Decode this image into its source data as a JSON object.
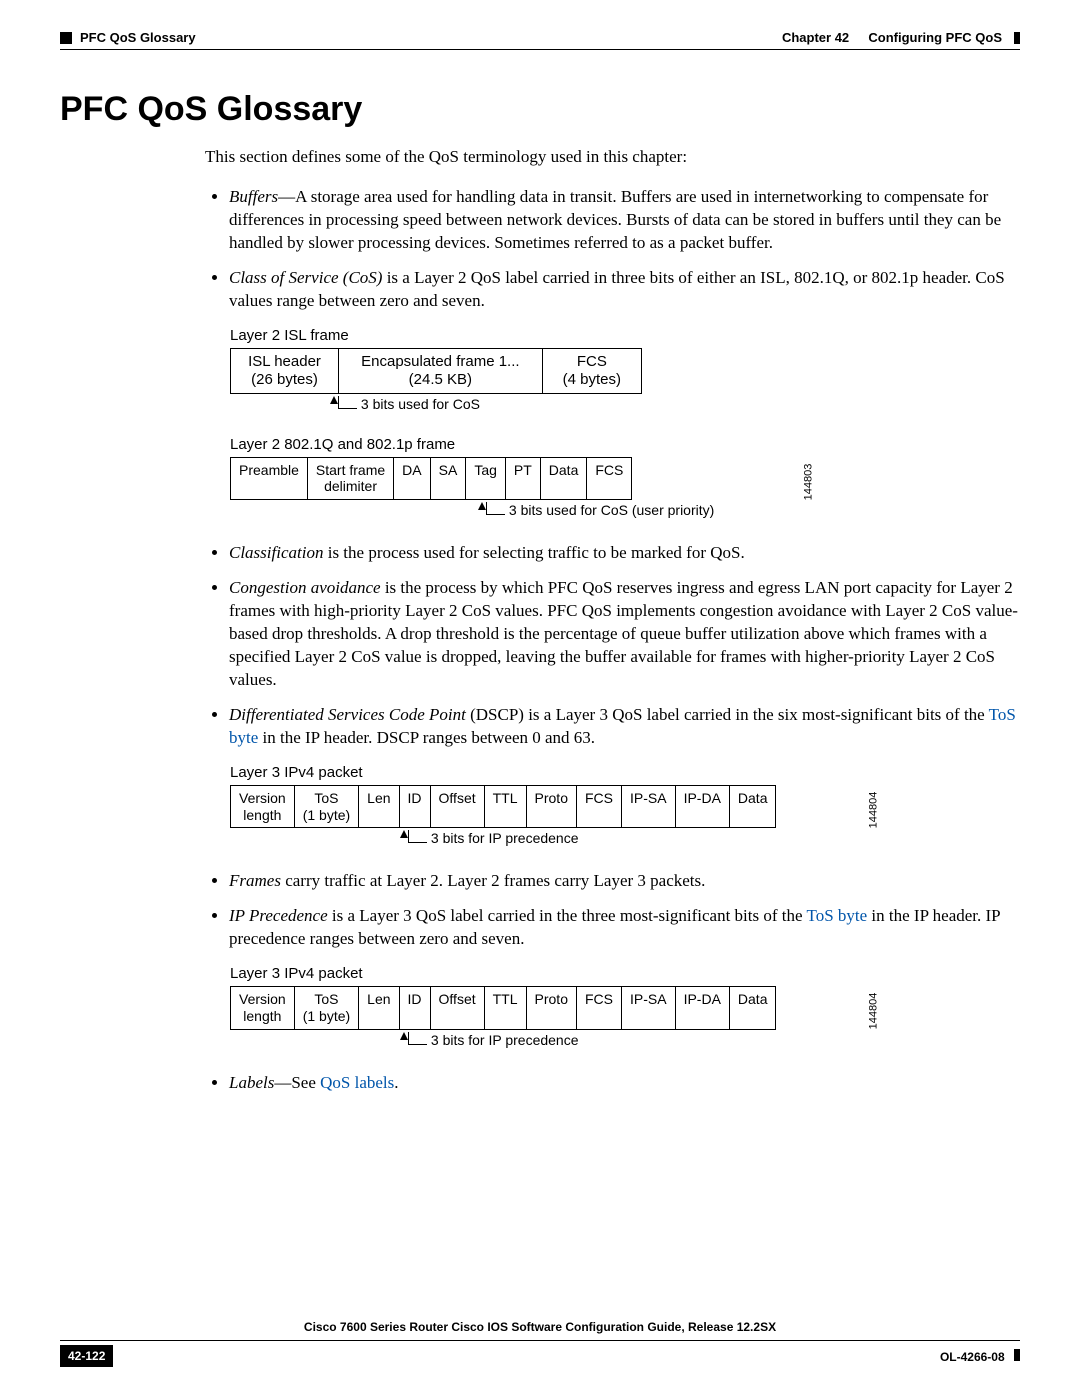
{
  "header": {
    "left_section": "PFC QoS Glossary",
    "right_chapter": "Chapter 42",
    "right_title": "Configuring PFC QoS"
  },
  "title": "PFC QoS Glossary",
  "intro": "This section defines some of the QoS terminology used in this chapter:",
  "items": {
    "buffers_term": "Buffers",
    "buffers_text": "—A storage area used for handling data in transit. Buffers are used in internetworking to compensate for differences in processing speed between network devices. Bursts of data can be stored in buffers until they can be handled by slower processing devices. Sometimes referred to as a packet buffer.",
    "cos_term": "Class of Service (CoS)",
    "cos_text": " is a Layer 2 QoS label carried in three bits of either an ISL, 802.1Q, or 802.1p header. CoS values range between zero and seven.",
    "classification_term": "Classification",
    "classification_text": " is the process used for selecting traffic to be marked for QoS.",
    "congestion_term": "Congestion avoidance",
    "congestion_text": " is the process by which PFC QoS reserves ingress and egress LAN port capacity for Layer 2 frames with high-priority Layer 2 CoS values. PFC QoS implements congestion avoidance with Layer 2 CoS value-based drop thresholds. A drop threshold is the percentage of queue buffer utilization above which frames with a specified Layer 2 CoS value is dropped, leaving the buffer available for frames with higher-priority Layer 2 CoS values.",
    "dscp_term": "Differentiated Services Code Point",
    "dscp_text_a": " (DSCP) is a Layer 3 QoS label carried in the six most-significant bits of the ",
    "dscp_link": "ToS byte",
    "dscp_text_b": " in the IP header. DSCP ranges between 0 and 63.",
    "frames_term": "Frames",
    "frames_text": " carry traffic at Layer 2. Layer 2 frames carry Layer 3 packets.",
    "ipprec_term": "IP Precedence",
    "ipprec_text_a": " is a Layer 3 QoS label carried in the three most-significant bits of the ",
    "ipprec_link": "ToS byte",
    "ipprec_text_b": " in the IP header. IP precedence ranges between zero and seven.",
    "labels_term": "Labels",
    "labels_sep": "—See ",
    "labels_link": "QoS labels",
    "labels_end": "."
  },
  "diagrams": {
    "isl": {
      "caption": "Layer 2 ISL frame",
      "cells": {
        "c0a": "ISL header",
        "c0b": "(26 bytes)",
        "c1a": "Encapsulated frame 1...",
        "c1b": "(24.5 KB)",
        "c2a": "FCS",
        "c2b": "(4 bytes)"
      },
      "annot": "3 bits used for CoS"
    },
    "dot1q": {
      "caption": "Layer 2 802.1Q and 802.1p frame",
      "cells": {
        "c0": "Preamble",
        "c1a": "Start frame",
        "c1b": "delimiter",
        "c2": "DA",
        "c3": "SA",
        "c4": "Tag",
        "c5": "PT",
        "c6": "Data",
        "c7": "FCS"
      },
      "annot": "3 bits used for CoS (user priority)",
      "figid": "144803"
    },
    "ipv4a": {
      "caption": "Layer 3 IPv4 packet",
      "cells": {
        "c0a": "Version",
        "c0b": "length",
        "c1a": "ToS",
        "c1b": "(1 byte)",
        "c2": "Len",
        "c3": "ID",
        "c4": "Offset",
        "c5": "TTL",
        "c6": "Proto",
        "c7": "FCS",
        "c8": "IP-SA",
        "c9": "IP-DA",
        "c10": "Data"
      },
      "annot": "3 bits for IP precedence",
      "figid": "144804"
    },
    "ipv4b": {
      "caption": "Layer 3 IPv4 packet",
      "cells": {
        "c0a": "Version",
        "c0b": "length",
        "c1a": "ToS",
        "c1b": "(1 byte)",
        "c2": "Len",
        "c3": "ID",
        "c4": "Offset",
        "c5": "TTL",
        "c6": "Proto",
        "c7": "FCS",
        "c8": "IP-SA",
        "c9": "IP-DA",
        "c10": "Data"
      },
      "annot": "3 bits for IP precedence",
      "figid": "144804"
    }
  },
  "footer": {
    "doc_title": "Cisco 7600 Series Router Cisco IOS Software Configuration Guide, Release 12.2SX",
    "page_num": "42-122",
    "doc_id": "OL-4266-08"
  }
}
